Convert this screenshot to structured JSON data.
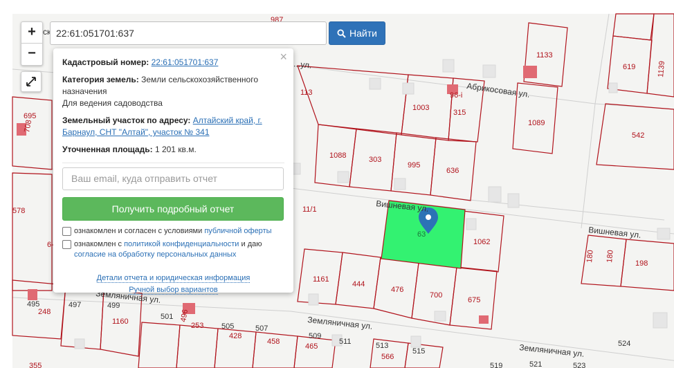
{
  "search": {
    "value": "22:61:051701:637",
    "button_label": "Найти"
  },
  "zoom": {
    "in_label": "+",
    "out_label": "−"
  },
  "popup": {
    "close_label": "×",
    "cadastral_label": "Кадастровый номер:",
    "cadastral_number": "22:61:051701:637",
    "category_label": "Категория земель:",
    "category_value": "Земли сельскохозяйственного назначения",
    "usage": "Для ведения садоводства",
    "address_label": "Земельный участок по адресу:",
    "address_value": "Алтайский край, г. Барнаул, СНТ \"Алтай\", участок № 341",
    "area_label": "Уточненная площадь:",
    "area_value": "1 201 кв.м.",
    "email_placeholder": "Ваш email, куда отправить отчет",
    "report_button": "Получить подробный отчет",
    "agree1_prefix": "ознакомлен и согласен с условиями",
    "agree1_link": "публичной оферты",
    "agree2_prefix": "ознакомлен с",
    "agree2_link1": "политикой конфиденциальности",
    "agree2_mid": "и даю",
    "agree2_link2": "согласие на обработку персональных данных",
    "details_link": "Детали отчета и юридическая информация",
    "manual_link": "Ручной выбор вариантов"
  },
  "map": {
    "colors": {
      "selected_parcel": "#33f271",
      "parcel_border": "#b0121b",
      "building": "#e06a73",
      "marker": "#2c73b6"
    },
    "streets": [
      "Абрикосовая ул.",
      "Вишневая ул.",
      "Вишневая ул.",
      "Земляничная ул.",
      "Земляничная ул.",
      "Земляничная ул.",
      "...ул."
    ],
    "street_fragments": [
      "ск",
      "96-i",
      "11/1",
      "6-",
      "Вишневая ул."
    ],
    "parcel_labels": [
      "987",
      "1133",
      "619",
      "1139",
      "113",
      "1003",
      "315",
      "1089",
      "542",
      "695",
      "708",
      "1088",
      "303",
      "995",
      "636",
      "578",
      "1062",
      "180",
      "180",
      "198",
      "1161",
      "444",
      "476",
      "700",
      "675",
      "495",
      "497",
      "499",
      "248",
      "1160",
      "501",
      "496",
      "253",
      "505",
      "428",
      "507",
      "458",
      "509",
      "465",
      "511",
      "513",
      "566",
      "515",
      "524",
      "519",
      "521",
      "523",
      "355",
      "63"
    ]
  }
}
